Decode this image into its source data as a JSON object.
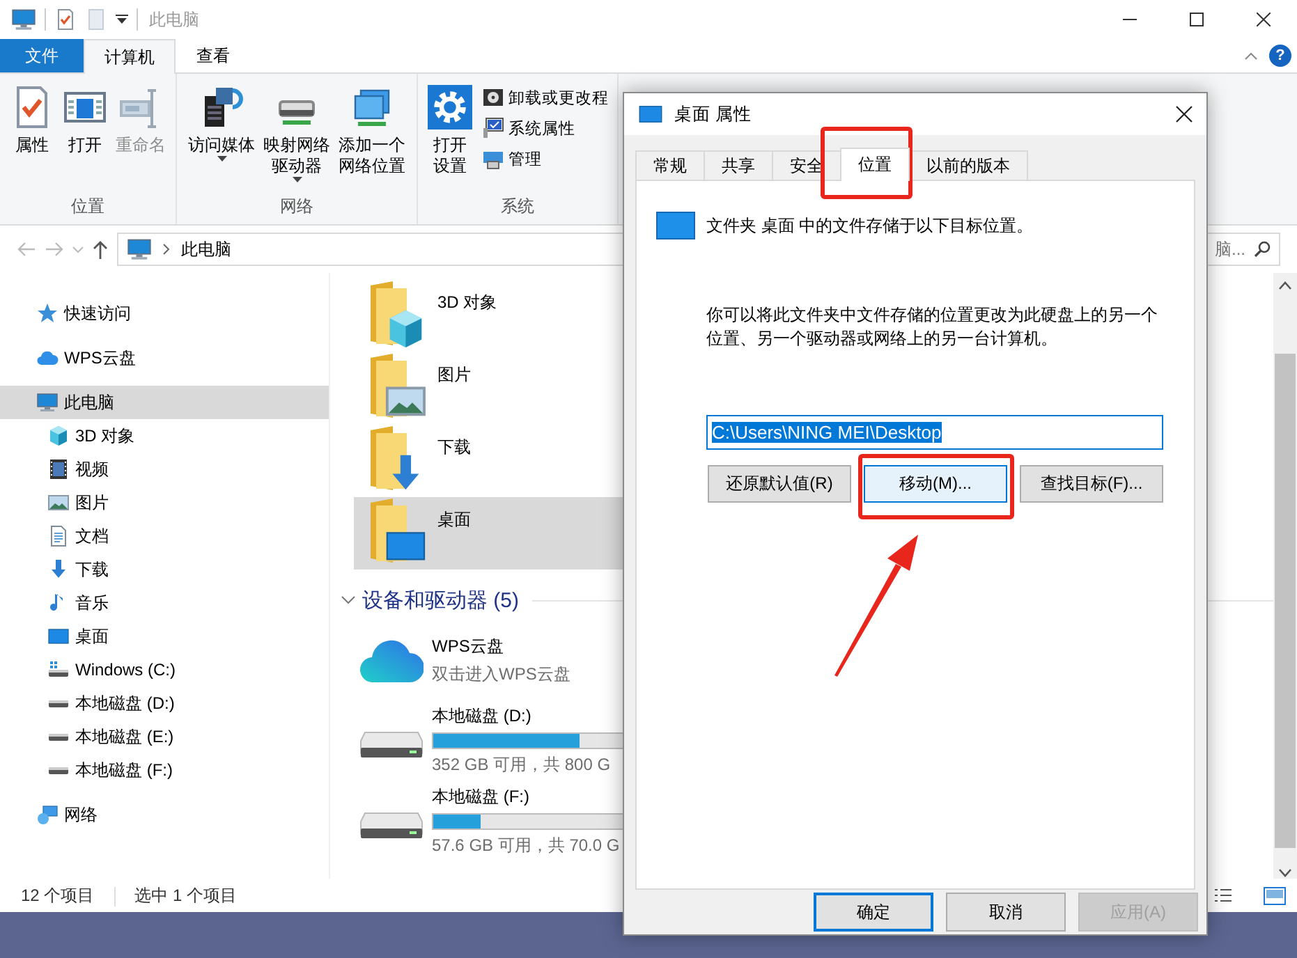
{
  "explorer": {
    "title": "此电脑",
    "ribbon_tabs": [
      {
        "label": "文件",
        "kind": "menu",
        "selected": false
      },
      {
        "label": "计算机",
        "kind": "tab",
        "selected": true
      },
      {
        "label": "查看",
        "kind": "tab",
        "selected": false
      }
    ],
    "help": "?",
    "ribbon_groups": [
      {
        "label": "位置",
        "buttons": [
          {
            "label": "属性",
            "kind": "properties",
            "disabled": false,
            "has_menu": false
          },
          {
            "label": "打开",
            "kind": "open",
            "disabled": false,
            "has_menu": false
          },
          {
            "label": "重命名",
            "kind": "rename",
            "disabled": true,
            "has_menu": false
          }
        ]
      },
      {
        "label": "网络",
        "buttons": [
          {
            "label": "访问媒体",
            "kind": "media",
            "disabled": false,
            "has_menu": true
          },
          {
            "label": "映射网络驱动器",
            "kind": "mapdrive",
            "disabled": false,
            "has_menu": true
          },
          {
            "label": "添加一个网络位置",
            "kind": "addnet",
            "disabled": false,
            "has_menu": false
          }
        ]
      },
      {
        "label": "系统",
        "buttons": [
          {
            "label": "打开设置",
            "kind": "settings",
            "disabled": false,
            "has_menu": false
          }
        ],
        "small_buttons": [
          {
            "label": "卸载或更改程",
            "kind": "uninstall"
          },
          {
            "label": "系统属性",
            "kind": "sysprops"
          },
          {
            "label": "管理",
            "kind": "manage"
          }
        ]
      }
    ],
    "address": {
      "path": "此电脑",
      "search": "脑..."
    },
    "nav": [
      {
        "label": "快速访问",
        "kind": "star",
        "selected": false
      },
      {
        "label": "WPS云盘",
        "kind": "cloud",
        "selected": false
      },
      {
        "label": "此电脑",
        "kind": "pc",
        "selected": true,
        "children": [
          {
            "label": "3D 对象",
            "kind": "cube",
            "selected": false
          },
          {
            "label": "视频",
            "kind": "video",
            "selected": false
          },
          {
            "label": "图片",
            "kind": "picture",
            "selected": false
          },
          {
            "label": "文档",
            "kind": "document",
            "selected": false
          },
          {
            "label": "下载",
            "kind": "download",
            "selected": false
          },
          {
            "label": "音乐",
            "kind": "music",
            "selected": false
          },
          {
            "label": "桌面",
            "kind": "desktop",
            "selected": false
          },
          {
            "label": "Windows (C:)",
            "kind": "sysdrive",
            "selected": false
          },
          {
            "label": "本地磁盘 (D:)",
            "kind": "drive",
            "selected": false
          },
          {
            "label": "本地磁盘 (E:)",
            "kind": "drive",
            "selected": false
          },
          {
            "label": "本地磁盘 (F:)",
            "kind": "drive",
            "selected": false
          }
        ]
      },
      {
        "label": "网络",
        "kind": "network",
        "selected": false
      }
    ],
    "folders": [
      {
        "label": "3D 对象",
        "kind": "cube",
        "selected": false
      },
      {
        "label": "图片",
        "kind": "picture",
        "selected": false
      },
      {
        "label": "下载",
        "kind": "download",
        "selected": false
      },
      {
        "label": "桌面",
        "kind": "desktop",
        "selected": true
      }
    ],
    "devices": {
      "title": "设备和驱动器 (5)",
      "expanded": true,
      "drives": [
        {
          "kind": "cloud",
          "name": "WPS云盘",
          "subtitle": "双击进入WPS云盘"
        },
        {
          "kind": "disk",
          "name": "本地磁盘 (D:)",
          "level": 0.56,
          "free": "352 GB 可用，共 800 G"
        },
        {
          "kind": "disk",
          "name": "本地磁盘 (F:)",
          "level": 0.18,
          "free": "57.6 GB 可用，共 70.0 G"
        }
      ]
    },
    "status": {
      "items": "12 个项目",
      "selection": "选中 1 个项目"
    }
  },
  "dialog": {
    "title": "桌面 属性",
    "tabs": [
      {
        "label": "常规",
        "selected": false,
        "annotated": false
      },
      {
        "label": "共享",
        "selected": false,
        "annotated": false
      },
      {
        "label": "安全",
        "selected": false,
        "annotated": false
      },
      {
        "label": "位置",
        "selected": true,
        "annotated": true
      },
      {
        "label": "以前的版本",
        "selected": false,
        "annotated": false
      }
    ],
    "heading": "文件夹 桌面 中的文件存储于以下目标位置。",
    "description": "你可以将此文件夹中文件存储的位置更改为此硬盘上的另一个位置、另一个驱动器或网络上的另一台计算机。",
    "path": "C:\\Users\\NING MEI\\Desktop",
    "path_selected": true,
    "actions": [
      {
        "label": "还原默认值(R)",
        "focused": false,
        "annotated": false
      },
      {
        "label": "移动(M)...",
        "focused": true,
        "annotated": true
      },
      {
        "label": "查找目标(F)...",
        "focused": false,
        "annotated": false
      }
    ],
    "buttons": [
      {
        "label": "确定",
        "default": true,
        "disabled": false
      },
      {
        "label": "取消",
        "default": false,
        "disabled": false
      },
      {
        "label": "应用(A)",
        "default": false,
        "disabled": true
      }
    ]
  }
}
